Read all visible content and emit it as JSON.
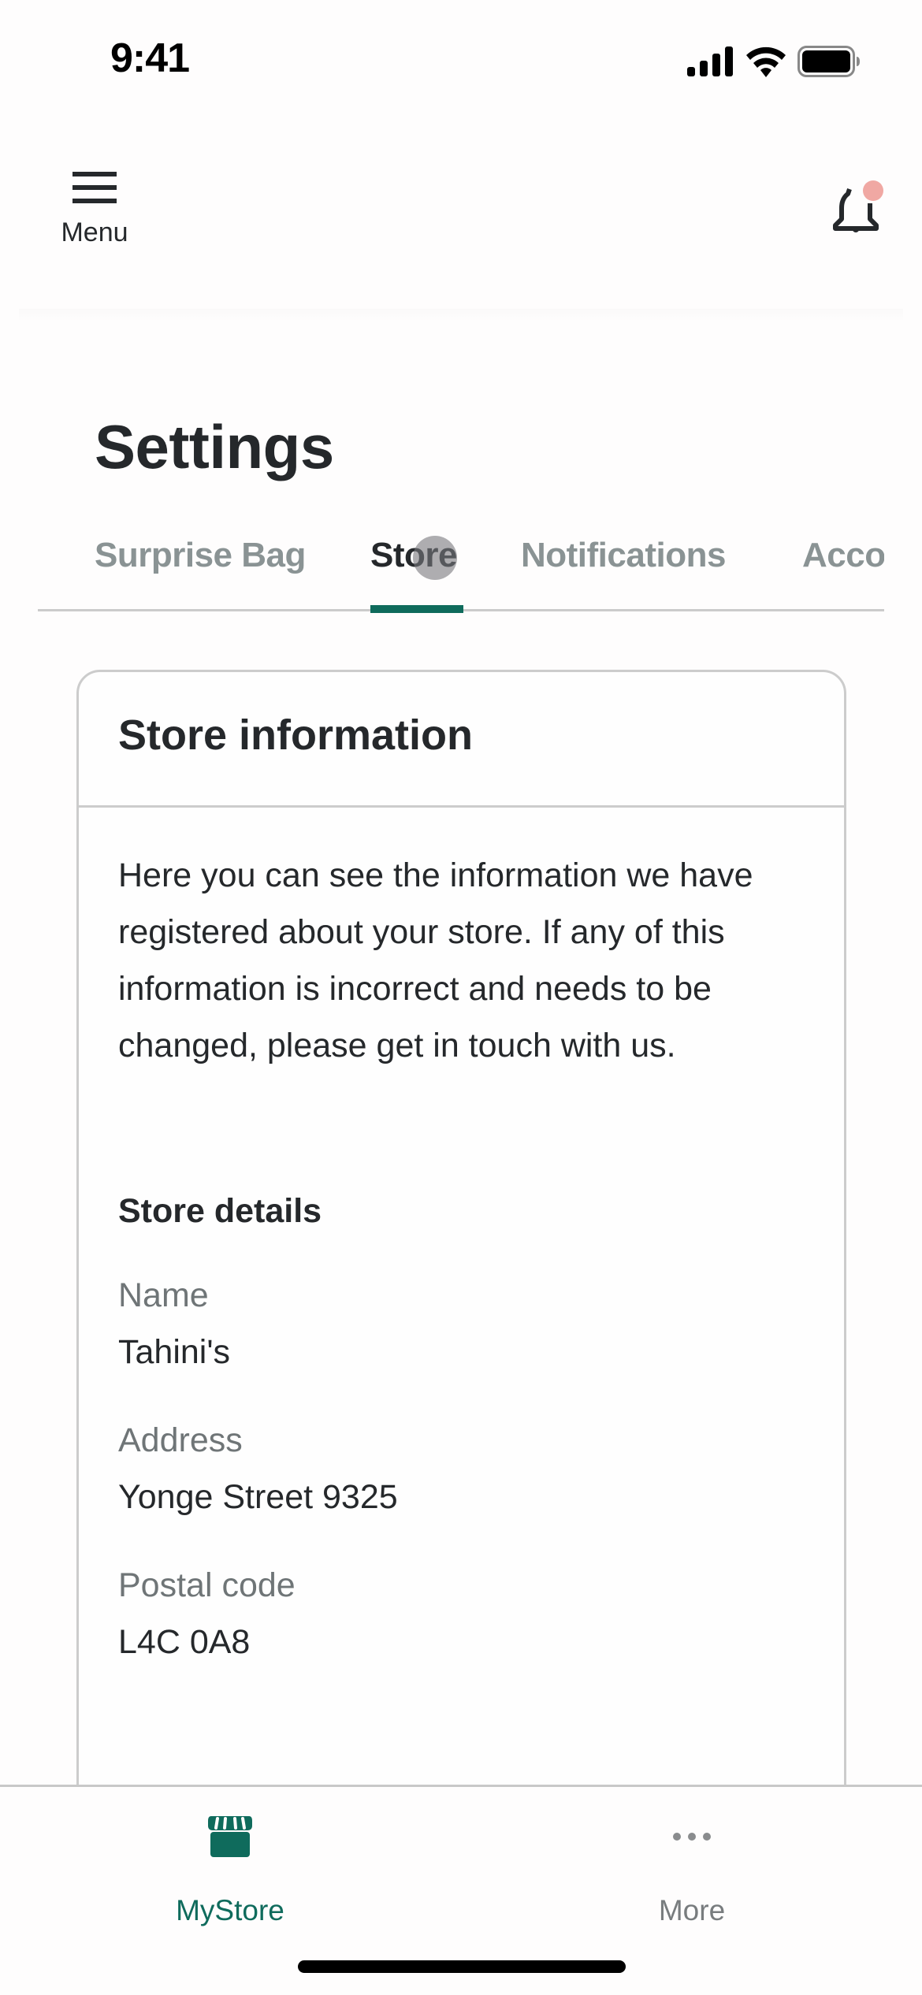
{
  "status_bar": {
    "time": "9:41",
    "icons": [
      "cellular-signal-icon",
      "wifi-icon",
      "battery-icon"
    ]
  },
  "header": {
    "menu_label": "Menu",
    "menu_icon": "hamburger-icon",
    "notification_icon": "bell-icon",
    "notification_badge": true,
    "badge_color": "#f0a8a3"
  },
  "page": {
    "title": "Settings"
  },
  "tabs": [
    {
      "label": "Surprise Bag",
      "active": false
    },
    {
      "label": "Store",
      "active": true
    },
    {
      "label": "Notifications",
      "active": false
    },
    {
      "label": "Account",
      "active": false
    }
  ],
  "card": {
    "title": "Store information",
    "description": "Here you can see the information we have registered about your store. If any of this information is incorrect and needs to be changed, please get in touch with us.",
    "section_title": "Store details",
    "fields": [
      {
        "label": "Name",
        "value": "Tahini's"
      },
      {
        "label": "Address",
        "value": "Yonge Street 9325"
      },
      {
        "label": "Postal code",
        "value": "L4C 0A8"
      }
    ]
  },
  "bottom_nav": {
    "items": [
      {
        "label": "MyStore",
        "icon": "storefront-icon",
        "active": true
      },
      {
        "label": "More",
        "icon": "more-dots-icon",
        "active": false
      }
    ]
  },
  "colors": {
    "accent": "#0f6b5c",
    "text_primary": "#25282b",
    "text_secondary": "#6f7577",
    "tab_inactive": "#8a9394",
    "border": "#cccccc"
  }
}
